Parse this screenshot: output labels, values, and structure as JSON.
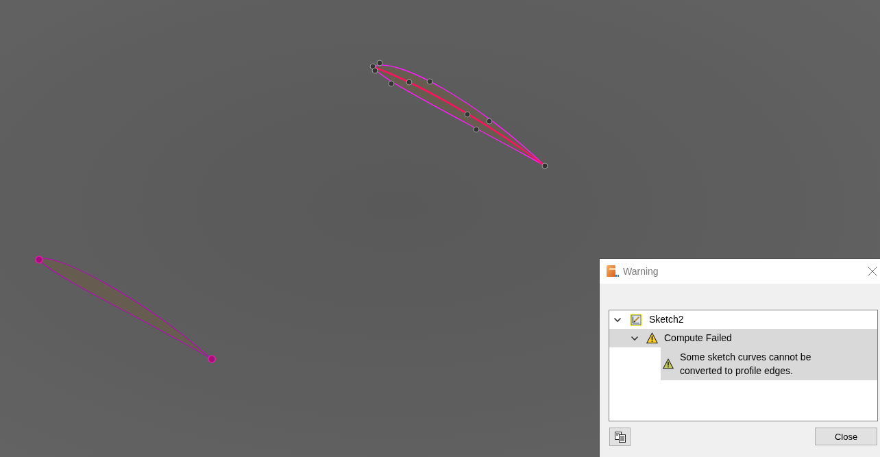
{
  "canvas": {
    "profiles": [
      {
        "selected": true
      },
      {
        "selected": false
      }
    ]
  },
  "dialog": {
    "title": "Warning",
    "tree": [
      {
        "label": "Sketch2",
        "kind": "sketch",
        "expanded": true,
        "selected": false,
        "children": [
          {
            "label": "Compute Failed",
            "kind": "warning",
            "expanded": true,
            "selected": true,
            "children": [
              {
                "label": "Some sketch curves cannot be converted to profile edges.",
                "kind": "message",
                "selected": true
              }
            ]
          }
        ]
      }
    ],
    "buttons": [
      {
        "kind": "copy"
      },
      {
        "kind": "text",
        "label": "Close"
      }
    ]
  }
}
